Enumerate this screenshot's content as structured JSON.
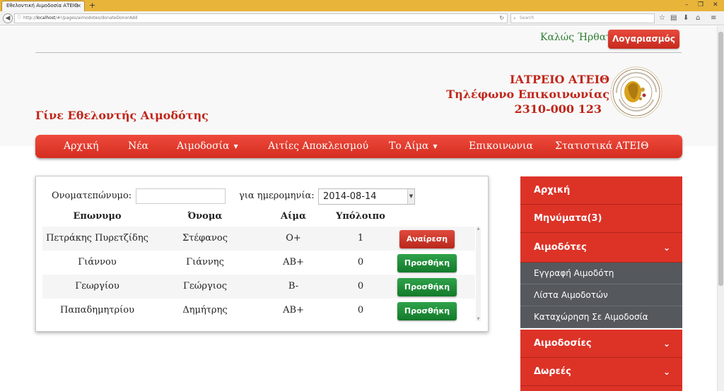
{
  "browser": {
    "tab_title": "Εθελοντική Αιμοδοσία ΑΤΕΙΘ",
    "url_prefix": "http://",
    "url_host": "localhost",
    "url_path": "/#!/pages/aimodotes/donateDonorAdd",
    "search_placeholder": "Search"
  },
  "header": {
    "welcome": "Καλώς Ήρθατε",
    "account_button": "Λογαριασμός",
    "clinic_name": "ΙΑΤΡΕΙΟ ΑΤΕΙΘ",
    "phone_label": "Τηλέφωνο Επικοινωνίας",
    "phone_number": "2310-000 123",
    "slogan": "Γίνε Εθελοντής Αιμοδότης"
  },
  "nav": {
    "items": [
      {
        "label": "Αρχική"
      },
      {
        "label": "Νέα"
      },
      {
        "label": "Αιμοδοσία"
      },
      {
        "label": "Αιτίες Αποκλεισμού"
      },
      {
        "label": "Το Αίμα"
      },
      {
        "label": "Επικοινωνια"
      },
      {
        "label": "Στατιστικά ΑΤΕΙΘ"
      }
    ]
  },
  "form": {
    "name_label": "Ονοματεπώνυμο:",
    "name_value": "",
    "date_label": "για ημερομηνία:",
    "date_value": "2014-08-14"
  },
  "table": {
    "headers": [
      "Επωνυμο",
      "Όνομα",
      "Αίμα",
      "Υπόλοιπο"
    ],
    "rows": [
      {
        "surname": "Πετράκης Πυρετζίδης",
        "name": "Στέφανος",
        "blood": "O+",
        "balance": "1",
        "action": "Αναίρεση"
      },
      {
        "surname": "Γιάννου",
        "name": "Γιάννης",
        "blood": "AB+",
        "balance": "0",
        "action": "Προσθήκη"
      },
      {
        "surname": "Γεωργίου",
        "name": "Γεώργιος",
        "blood": "B-",
        "balance": "0",
        "action": "Προσθήκη"
      },
      {
        "surname": "Παπαδημητρίου",
        "name": "Δημήτρης",
        "blood": "AB+",
        "balance": "0",
        "action": "Προσθήκη"
      }
    ]
  },
  "sidebar": {
    "items": [
      {
        "label": "Αρχική"
      },
      {
        "label": "Μηνύματα(3)"
      },
      {
        "label": "Αιμοδότες"
      },
      {
        "label": "Εγγραφή Αιμοδότη"
      },
      {
        "label": "Λίστα Αιμοδοτών"
      },
      {
        "label": "Καταχώρηση Σε Αιμοδοσία"
      },
      {
        "label": "Αιμοδοσίες"
      },
      {
        "label": "Δωρεές"
      }
    ]
  },
  "colors": {
    "brand_red": "#dd3327",
    "success_green": "#1e8f38",
    "welcome_green": "#2e7d32",
    "submenu_gray": "#55585d"
  }
}
